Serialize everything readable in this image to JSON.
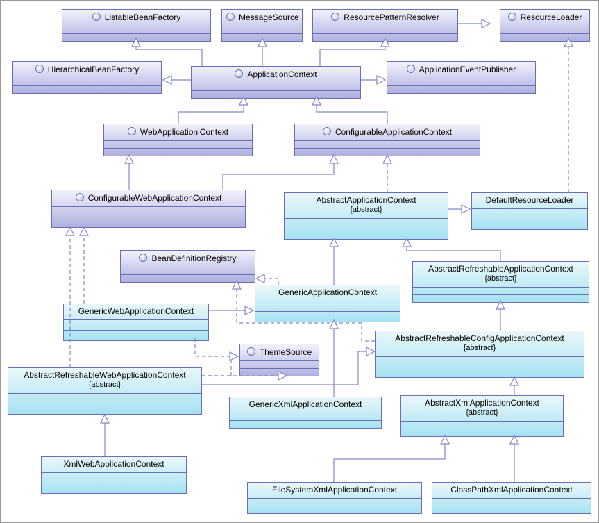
{
  "diagram": {
    "kind": "UML class diagram",
    "framework": "Spring ApplicationContext hierarchy"
  },
  "boxes": {
    "listableBeanFactory": {
      "label": "ListableBeanFactory",
      "type": "interface"
    },
    "messageSource": {
      "label": "MessageSource",
      "type": "interface"
    },
    "resourcePatternResolver": {
      "label": "ResourcePatternResolver",
      "type": "interface"
    },
    "resourceLoader": {
      "label": "ResourceLoader",
      "type": "interface"
    },
    "hierarchicalBeanFactory": {
      "label": "HierarchicalBeanFactory",
      "type": "interface"
    },
    "applicationContext": {
      "label": "ApplicationContext",
      "type": "interface"
    },
    "applicationEventPublisher": {
      "label": "ApplicationEventPublisher",
      "type": "interface"
    },
    "webApplicationContext": {
      "label": "WebApplicationiContext",
      "type": "interface"
    },
    "configurableApplicationContext": {
      "label": "ConfigurableApplicationContext",
      "type": "interface"
    },
    "configurableWebApplicationContext": {
      "label": "ConfigurableWebApplicationContext",
      "type": "interface"
    },
    "beanDefinitionRegistry": {
      "label": "BeanDefinitionRegistry",
      "type": "interface"
    },
    "themeSource": {
      "label": "ThemeSource",
      "type": "interface"
    },
    "abstractApplicationContext": {
      "label": "AbstractApplicationContext",
      "stereo": "{abstract}",
      "type": "class"
    },
    "defaultResourceLoader": {
      "label": "DefaultResourceLoader",
      "type": "class"
    },
    "genericApplicationContext": {
      "label": "GenericApplicationContext",
      "type": "class"
    },
    "abstractRefreshableApplicationContext": {
      "label": "AbstractRefreshableApplicationContext",
      "stereo": "{abstract}",
      "type": "class"
    },
    "genericWebApplicationContext": {
      "label": "GenericWebApplicationContext",
      "type": "class"
    },
    "abstractRefreshableConfigApplicationContext": {
      "label": "AbstractRefreshableConfigApplicationContext",
      "stereo": "{abstract}",
      "type": "class"
    },
    "abstractRefreshableWebApplicationContext": {
      "label": "AbstractRefreshableWebApplicationContext",
      "stereo": "{abstract}",
      "type": "class"
    },
    "genericXmlApplicationContext": {
      "label": "GenericXmlApplicationContext",
      "type": "class"
    },
    "abstractXmlApplicationContext": {
      "label": "AbstractXmlApplicationContext",
      "stereo": "{abstract}",
      "type": "class"
    },
    "xmlWebApplicationContext": {
      "label": "XmlWebApplicationContext",
      "type": "class"
    },
    "fileSystemXmlApplicationContext": {
      "label": "FileSystemXmlApplicationContext",
      "type": "class"
    },
    "classPathXmlApplicationContext": {
      "label": "ClassPathXmlApplicationContext",
      "type": "class"
    }
  },
  "relationships": [
    {
      "from": "applicationContext",
      "to": "listableBeanFactory",
      "kind": "generalization"
    },
    {
      "from": "applicationContext",
      "to": "messageSource",
      "kind": "generalization"
    },
    {
      "from": "applicationContext",
      "to": "resourcePatternResolver",
      "kind": "generalization"
    },
    {
      "from": "resourcePatternResolver",
      "to": "resourceLoader",
      "kind": "generalization"
    },
    {
      "from": "applicationContext",
      "to": "hierarchicalBeanFactory",
      "kind": "generalization"
    },
    {
      "from": "applicationContext",
      "to": "applicationEventPublisher",
      "kind": "generalization"
    },
    {
      "from": "webApplicationContext",
      "to": "applicationContext",
      "kind": "generalization"
    },
    {
      "from": "configurableApplicationContext",
      "to": "applicationContext",
      "kind": "generalization"
    },
    {
      "from": "configurableWebApplicationContext",
      "to": "webApplicationContext",
      "kind": "generalization"
    },
    {
      "from": "configurableWebApplicationContext",
      "to": "configurableApplicationContext",
      "kind": "generalization"
    },
    {
      "from": "abstractApplicationContext",
      "to": "configurableApplicationContext",
      "kind": "realization"
    },
    {
      "from": "defaultResourceLoader",
      "to": "resourceLoader",
      "kind": "realization"
    },
    {
      "from": "abstractApplicationContext",
      "to": "defaultResourceLoader",
      "kind": "generalization"
    },
    {
      "from": "genericApplicationContext",
      "to": "abstractApplicationContext",
      "kind": "generalization"
    },
    {
      "from": "genericApplicationContext",
      "to": "beanDefinitionRegistry",
      "kind": "realization"
    },
    {
      "from": "abstractRefreshableApplicationContext",
      "to": "abstractApplicationContext",
      "kind": "generalization"
    },
    {
      "from": "genericWebApplicationContext",
      "to": "genericApplicationContext",
      "kind": "generalization"
    },
    {
      "from": "genericWebApplicationContext",
      "to": "configurableWebApplicationContext",
      "kind": "realization"
    },
    {
      "from": "genericWebApplicationContext",
      "to": "themeSource",
      "kind": "realization"
    },
    {
      "from": "abstractRefreshableConfigApplicationContext",
      "to": "abstractRefreshableApplicationContext",
      "kind": "generalization"
    },
    {
      "from": "abstractRefreshableConfigApplicationContext",
      "to": "beanDefinitionRegistry",
      "kind": "realization"
    },
    {
      "from": "abstractRefreshableWebApplicationContext",
      "to": "abstractRefreshableConfigApplicationContext",
      "kind": "generalization"
    },
    {
      "from": "abstractRefreshableWebApplicationContext",
      "to": "configurableWebApplicationContext",
      "kind": "realization"
    },
    {
      "from": "abstractRefreshableWebApplicationContext",
      "to": "themeSource",
      "kind": "realization"
    },
    {
      "from": "genericXmlApplicationContext",
      "to": "genericApplicationContext",
      "kind": "generalization"
    },
    {
      "from": "abstractXmlApplicationContext",
      "to": "abstractRefreshableConfigApplicationContext",
      "kind": "generalization"
    },
    {
      "from": "xmlWebApplicationContext",
      "to": "abstractRefreshableWebApplicationContext",
      "kind": "generalization"
    },
    {
      "from": "fileSystemXmlApplicationContext",
      "to": "abstractXmlApplicationContext",
      "kind": "generalization"
    },
    {
      "from": "classPathXmlApplicationContext",
      "to": "abstractXmlApplicationContext",
      "kind": "generalization"
    }
  ]
}
